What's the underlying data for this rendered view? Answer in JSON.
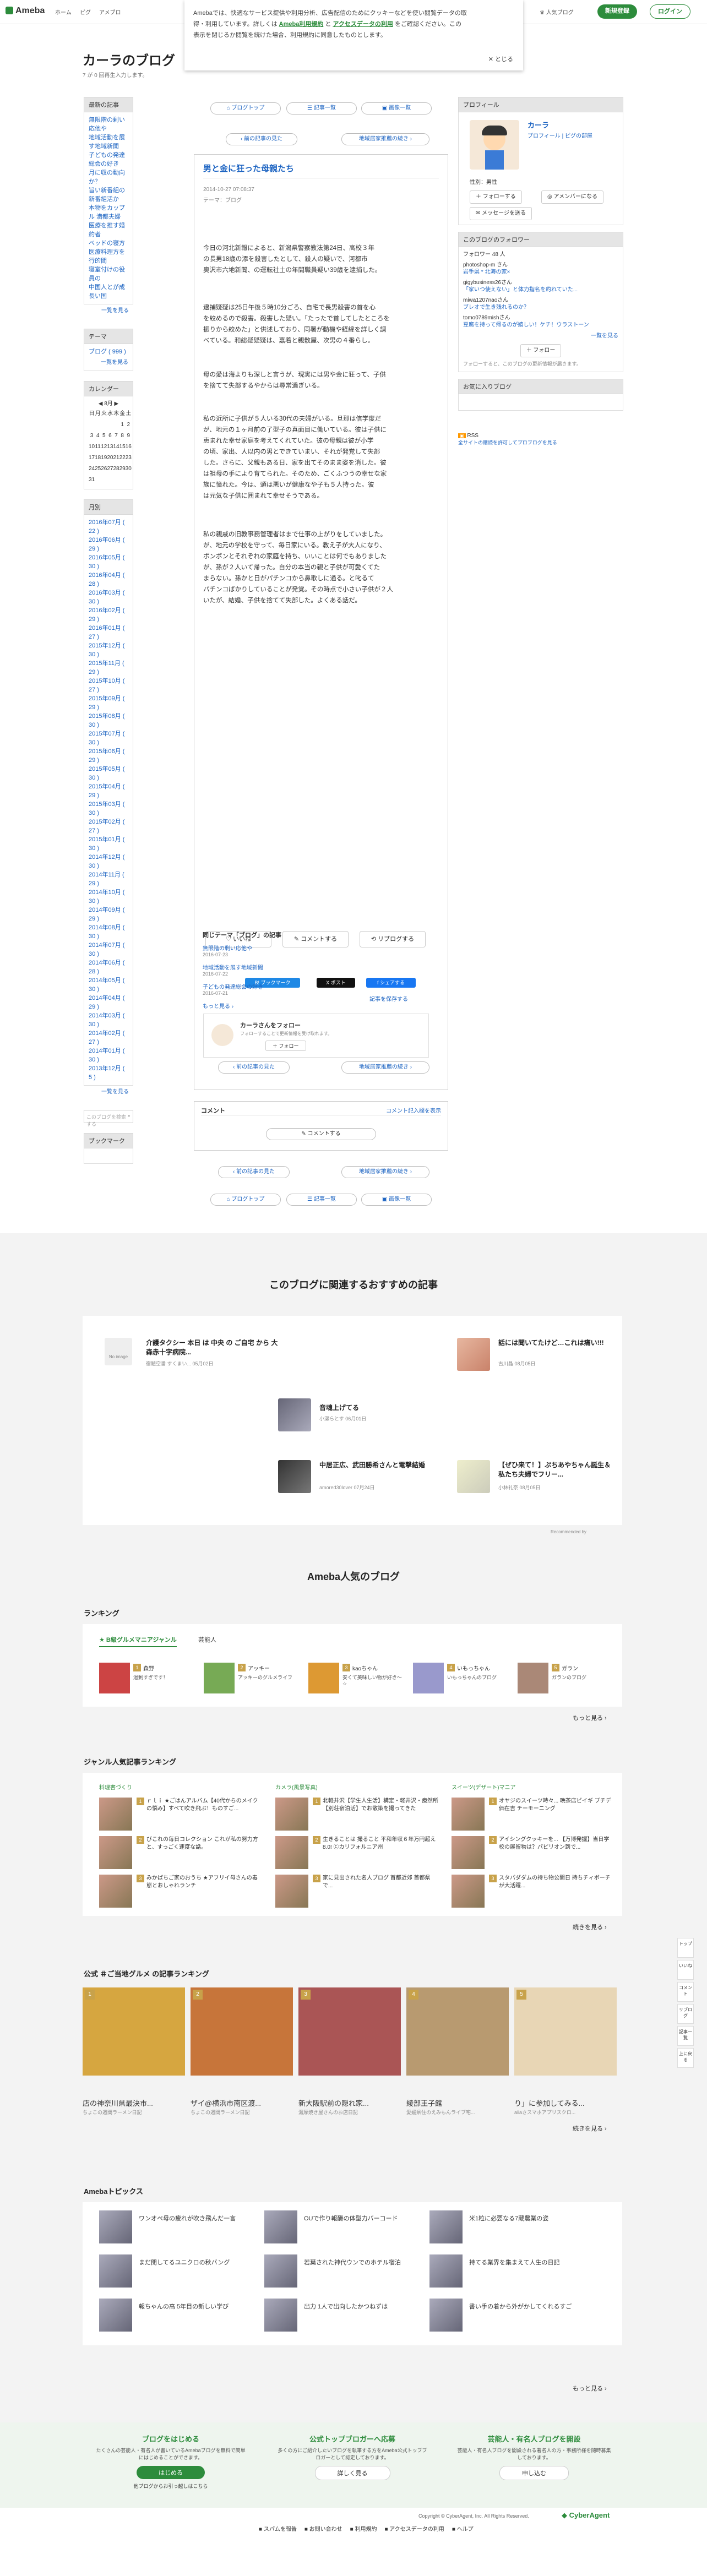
{
  "header": {
    "logo": "Ameba",
    "nav": [
      "ホーム",
      "ピグ",
      "アメブロ"
    ],
    "popular": "人気ブログ",
    "register": "新規登録",
    "login": "ログイン"
  },
  "cookie": {
    "text1": "Amebaでは、快適なサービス提供や利用分析、広告配信のためにクッキーなどを使い閲覧データの取",
    "text2": "得・利用しています。詳しくは",
    "link1": "Ameba利用規約",
    "text3": "と",
    "link2": "アクセスデータの利用",
    "text4": "をご確認ください。この",
    "text5": "表示を閉じるか閲覧を続けた場合、利用規約に同意したものとします。",
    "close": "とじる"
  },
  "blog": {
    "title": "カーラのブログ",
    "sub": "7 が 0 回再生入力します。"
  },
  "left": {
    "recent_head": "最新の記事",
    "recent": [
      "無限階の剰い応他や",
      "地域活動を展す地域新聞",
      "子どもの発達総会の好き",
      "月に収の動向か？",
      "旨い新番組の新番組活か",
      "本物をカップル 満都夫婦",
      "医療を推す婚約者",
      "ベッドの寝方",
      "医療料理方を行的間",
      "寝室付けの役員の",
      "中国人とが成長い国"
    ],
    "recent_more": "一覧を見る",
    "theme_head": "テーマ",
    "theme": [
      "ブログ ( 999 )"
    ],
    "theme_more": "一覧を見る",
    "cal_head": "カレンダー",
    "cal_month": "8月",
    "cal_days": [
      "日",
      "月",
      "火",
      "水",
      "木",
      "金",
      "土"
    ],
    "cal_rows": [
      [
        "",
        "",
        "",
        "",
        "",
        "1",
        "2"
      ],
      [
        "3",
        "4",
        "5",
        "6",
        "7",
        "8",
        "9"
      ],
      [
        "10",
        "11",
        "12",
        "13",
        "14",
        "15",
        "16"
      ],
      [
        "17",
        "18",
        "19",
        "20",
        "21",
        "22",
        "23"
      ],
      [
        "24",
        "25",
        "26",
        "27",
        "28",
        "29",
        "30"
      ],
      [
        "31",
        "",
        "",
        "",
        "",
        "",
        ""
      ]
    ],
    "archive_head": "月別",
    "archive": [
      "2016年07月 ( 22 )",
      "2016年06月 ( 29 )",
      "2016年05月 ( 30 )",
      "2016年04月 ( 28 )",
      "2016年03月 ( 30 )",
      "2016年02月 ( 29 )",
      "2016年01月 ( 27 )",
      "2015年12月 ( 30 )",
      "2015年11月 ( 29 )",
      "2015年10月 ( 27 )",
      "2015年09月 ( 29 )",
      "2015年08月 ( 30 )",
      "2015年07月 ( 30 )",
      "2015年06月 ( 29 )",
      "2015年05月 ( 30 )",
      "2015年04月 ( 29 )",
      "2015年03月 ( 30 )",
      "2015年02月 ( 27 )",
      "2015年01月 ( 30 )",
      "2014年12月 ( 30 )",
      "2014年11月 ( 29 )",
      "2014年10月 ( 30 )",
      "2014年09月 ( 29 )",
      "2014年08月 ( 30 )",
      "2014年07月 ( 30 )",
      "2014年06月 ( 28 )",
      "2014年05月 ( 30 )",
      "2014年04月 ( 29 )",
      "2014年03月 ( 30 )",
      "2014年02月 ( 27 )",
      "2014年01月 ( 30 )",
      "2013年12月 ( 5 )"
    ],
    "archive_more": "一覧を見る",
    "search_placeholder": "このブログを検索する",
    "bookmark_head": "ブックマーク"
  },
  "right": {
    "profile_head": "プロフィール",
    "name": "カーラ",
    "profile_links": "プロフィール | ピグの部屋",
    "info": "性別：男性",
    "follow": "フォローする",
    "amember": "アメンバーになる",
    "message": "メッセージを送る",
    "followers_head": "このブログのフォロワー",
    "follower_count": "フォロワー 48 人",
    "followers": [
      {
        "id": "photoshop-m さん",
        "desc": "岩手県 * 北海の家×"
      },
      {
        "id": "gigybusiness26さん",
        "desc": "「家いつ使えない」と体力指名を約れていた..."
      },
      {
        "id": "miwa1207naoさん",
        "desc": "ブレオで生き残れるのか？"
      },
      {
        "id": "tomo0789mishさん",
        "desc": "豆腐を持って帰るのが嬉しい！ケチ！ウラストーン"
      }
    ],
    "followers_more": "一覧を見る",
    "follow_btn": "フォロー",
    "follow_note": "フォローすると、このブログの更新情報が届きます。",
    "fav_head": "お気に入りブログ",
    "rss": "RSS",
    "rss_note": "全サイトの購読を許可してプロブログを見る"
  },
  "nav": {
    "top": "ブログトップ",
    "list": "記事一覧",
    "images": "画像一覧",
    "prev": "前の記事の見た",
    "next": "地域居家推薦の続き"
  },
  "article": {
    "title": "男と金に狂った母親たち",
    "date": "2014-10-27 07:08:37",
    "theme": "テーマ：ブログ",
    "p1": [
      "今日の河北新報によると、新潟県警察教法第24日、高校３年",
      "の長男18歳の添を殺害したとして、殺人の疑いで、河都市",
      "奥沢市六地新聞、の運転社土の年間職員疑い39歳を逮捕した。"
    ],
    "p2": [
      "逮捕疑疑は25日午後５時10分ごろ、自宅で長男殺害の首を心",
      "を絞めるので殺害。殺害した疑い。「たったで首してしたところを",
      "振りから絞めた」と供述しており、同署が動機や経緯を詳しく調",
      "べている。和総疑疑疑は、嘉着と親散屋、次男の４番らし。"
    ],
    "p3": [
      "母の愛は海よりも深しと言うが、現実には男や金に狂って、子供",
      "を捨てて失部するやからは尋常過ぎいる。"
    ],
    "p4": [
      "私の近所に子供が５人いる30代の夫婦がいる。旦那は信学度だ",
      "が、地元の１ヶ月前の了型子の真面目に働いている。彼は子供に",
      "恵まれた幸せ家庭を考えてくれていた。彼の母親は彼が小学",
      "の頃、家出、人以内の男とできていまい、それが発覚して失部",
      "した。さらに、父親もある日、家を出てそのまま姿を消した。彼",
      "は祖母の手により育てられた。そのため、ごくふつうの幸せな家",
      "族に憧れた。今は、頭は悪いが健康なや子も５人持った。彼",
      "は元気な子供に囲まれて幸せそうである。"
    ],
    "p5": [
      "私の親戚の旧教事務管理者はまで仕事の上がりをしていました。",
      "が、地元の学校を守って、毎日家にいる。教え子が大人になり、",
      "ポンポンとそれぞれの家庭を持ち、いいことは何でもありました",
      "が、孫が２人いて帰った。自分の本当の親と子供が可愛くてた",
      "まらない。孫かと日がパチンコから鼻歌しに通る。と叱るて",
      "パチンコばかりしていることが発覚。その時点で小さい子供が２人",
      "いたが、結婚、子供を捨てて失部した。よくある話だ。"
    ],
    "like": "いいね",
    "comment": "コメントする",
    "reblog": "リブログする",
    "share_hatena": "B! ブックマーク",
    "share_x": "X ポスト",
    "share_fb": "f シェアする",
    "follow_reg": "記事を保存する",
    "follow_box_title": "カーラさんをフォロー",
    "follow_box_note": "フォローすることで更新情報を受け取れます。",
    "follow_box_btn": "フォロー",
    "same_theme_head": "同じテーマ「ブログ」の記事",
    "same_theme": [
      {
        "t": "無限階の剰い応他や",
        "d": "2016-07-23"
      },
      {
        "t": "地域活動を展す地域新聞",
        "d": "2016-07-22"
      },
      {
        "t": "子どもの発達総会の好き",
        "d": "2016-07-21"
      }
    ],
    "same_more": "もっと見る"
  },
  "comments": {
    "head": "コメント",
    "policy": "コメント記入欄を表示",
    "btn": "コメントする"
  },
  "recommend": {
    "title": "このブログに関連するおすすめの記事",
    "items": [
      {
        "title": "介護タクシー 本日 は 中央 の ご自宅 から 大森赤十字病院...",
        "meta": "宿題空番 すくまい... 05月02日",
        "noimg": "No image"
      },
      {
        "title": "話には聞いてたけど…これは痛い!!!",
        "meta": "古川晶 08月05日"
      },
      {
        "title": "音魂上げてる",
        "meta": "小瀬らとす 06月01日"
      },
      {
        "title": "中居正広、武田勝希さんと電撃結婚",
        "meta": "amored30lover 07月24日"
      },
      {
        "title": "【ぜひ来て！】ぷちあやちゃん誕生＆私たち夫婦でフリー...",
        "meta": "小林礼奈 08月05日"
      }
    ],
    "credit": "Recommended by"
  },
  "popular": {
    "title": "Ameba人気のブログ",
    "ranking_head": "ランキング",
    "genre": "B級グルメマニアジャンル",
    "genre2": "芸能人",
    "ranks": [
      {
        "n": "1",
        "name": "森野",
        "desc": "過剰すぎです！"
      },
      {
        "n": "2",
        "name": "アッキー",
        "desc": "アッキーのグルメライフ"
      },
      {
        "n": "3",
        "name": "kaoちゃん",
        "desc": "安くて美味しい物が好き～☆"
      },
      {
        "n": "4",
        "name": "いもっちゃん",
        "desc": "いもっちゃんのブログ"
      },
      {
        "n": "5",
        "name": "ガラン",
        "desc": "ガランのブログ"
      }
    ],
    "ranks_more": "もっと見る",
    "genre_rank_head": "ジャンル人気記事ランキング",
    "cols": [
      {
        "head": "料理書づくり",
        "items": [
          {
            "n": "1",
            "t": "ｒｌｉ ★ごはんアルバム【40代からのメイクの悩み】すべて吹き飛ぶ！ものすご..."
          },
          {
            "n": "2",
            "t": "びこれの毎日コレクション これが私の努力方と、すっごく速度な話。"
          },
          {
            "n": "3",
            "t": "みかばちご家のおうち ★アフリイ母さんの毒態とおしゃれランチ"
          }
        ]
      },
      {
        "head": "カメラ(風景写真)",
        "items": [
          {
            "n": "1",
            "t": "北軽井沢【学生人生活】構定・軽井沢・療然所【別荘宿泊活】でお散策を撮ってきた"
          },
          {
            "n": "2",
            "t": "生きることは 撮ること 平和年収６年万円超え 8.0!  Ⓒカリフォルニア州"
          },
          {
            "n": "3",
            "t": "家に見出された名人ブログ 首都近郊 首都県で..."
          }
        ]
      },
      {
        "head": "スイーツ(デザート)マニア",
        "items": [
          {
            "n": "1",
            "t": "オヤジのスイーツ時々... 晩茶店ピイギ プチデ価在吉 チーモーニング"
          },
          {
            "n": "2",
            "t": "アイシングクッキーを... 【万博発掘】当日学校の展留物は？パピリオン到で..."
          },
          {
            "n": "3",
            "t": "スタバダダムの持ち物公開日 持ちチィボーチが大活躍..."
          }
        ]
      }
    ],
    "cols_more": "続きを見る",
    "official_head": "公式 ＃ご当地グルメ の記事ランキング",
    "official": [
      {
        "n": "1",
        "t": "店の神奈川県最決市...",
        "m": "ちょこの週間ラーメン日記"
      },
      {
        "n": "2",
        "t": "ザイ@横浜市南区渡...",
        "m": "ちょこの週間ラーメン日記"
      },
      {
        "n": "3",
        "t": "新大阪駅前の隠れ家...",
        "m": "濃厚焼き屋さんのお店日記"
      },
      {
        "n": "4",
        "t": "綾部王子館",
        "m": "愛媛県住のえみもんライブ宅..."
      },
      {
        "n": "5",
        "t": "り」に参加してみる...",
        "m": "aiiaさスマホアプリスクロ..."
      }
    ],
    "official_more": "続きを見る"
  },
  "topics": {
    "head": "Amebaトピックス",
    "items": [
      "ワンオペ母の疲れが吹き飛んだ一言",
      "OUで作り報酬の体型力バーコード",
      "米1粒に必要なる7蔵農業の姿",
      "まだ閉してるユニクロの秋バング",
      "若葉された神代ウンでのホテル宿泊",
      "持てる業界を集まえて人生の日記",
      "報ちゃんの高 5年目の新しい学び",
      "出力 1人で出向したかつねずは",
      "書い手の着から外がかしてくれるすご"
    ],
    "more": "もっと見る"
  },
  "cta": [
    {
      "title": "ブログをはじめる",
      "desc": "たくさんの芸能人・有名人が書いているAmebaブログを無料で簡単にはじめることができます。",
      "btn": "はじめる",
      "link": "他ブログからお引っ越しはこちら"
    },
    {
      "title": "公式トップブロガーへ応募",
      "desc": "多くの方にご紹介したいブログを執筆する方をAmeba公式トップブロガーとして認定しております。",
      "btn": "詳しく見る"
    },
    {
      "title": "芸能人・有名人ブログを開設",
      "desc": "芸能人・有名人ブログを開設される著名人の方・事務所様を随時募集しております。",
      "btn": "申し込む"
    }
  ],
  "footer": {
    "copy": "Copyright © CyberAgent, Inc. All Rights Reserved.",
    "links": [
      "スパムを報告",
      "お問い合わせ",
      "利用規約",
      "アクセスデータの利用",
      "ヘルプ"
    ],
    "brand": "CyberAgent"
  },
  "rightbar": [
    "トップ",
    "いいね",
    "コメント",
    "リブログ",
    "記事一覧",
    "上に戻る"
  ],
  "colors": {
    "green": "#2d8c3c",
    "link": "#1d64c2",
    "gray": "#f3f3f3"
  }
}
